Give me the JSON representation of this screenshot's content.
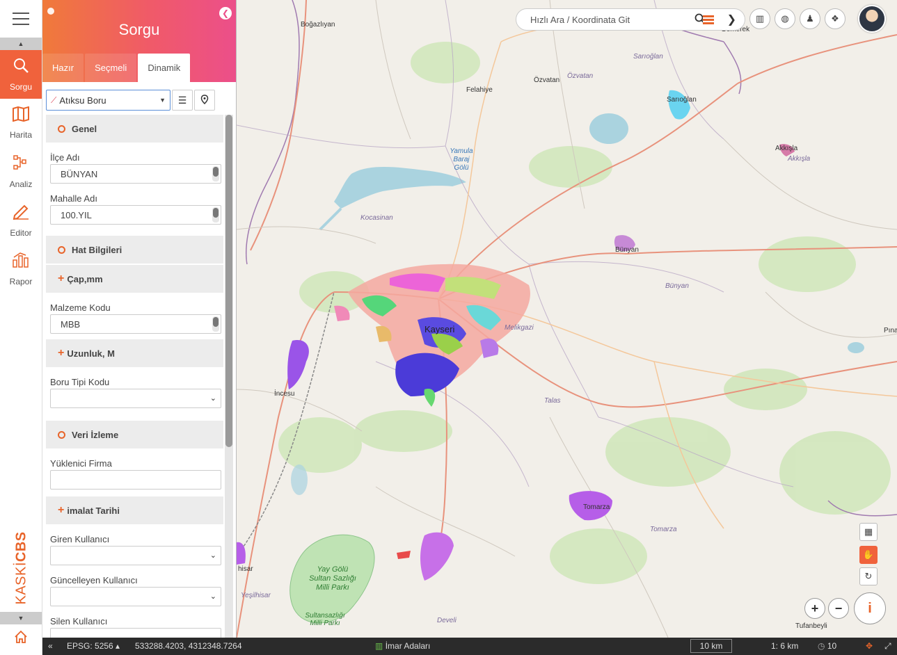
{
  "rail": {
    "items": [
      {
        "label": "Sorgu",
        "icon": "search-icon"
      },
      {
        "label": "Harita",
        "icon": "map-icon"
      },
      {
        "label": "Analiz",
        "icon": "analysis-icon"
      },
      {
        "label": "Editor",
        "icon": "editor-icon"
      },
      {
        "label": "Rapor",
        "icon": "report-icon"
      }
    ],
    "brand_a": "KASKİ",
    "brand_b": "CBS"
  },
  "panel": {
    "title": "Sorgu",
    "tabs": [
      "Hazır",
      "Seçmeli",
      "Dinamik"
    ],
    "active_tab": "Dinamik",
    "layer": "Atıksu Boru"
  },
  "form": {
    "genel": "Genel",
    "ilce_label": "İlçe Adı",
    "ilce_value": "BÜNYAN",
    "mahalle_label": "Mahalle Adı",
    "mahalle_value": "100.YIL",
    "hat": "Hat Bilgileri",
    "cap": "Çap,mm",
    "malzeme_label": "Malzeme Kodu",
    "malzeme_value": "MBB",
    "uzunluk": "Uzunluk, M",
    "boru_tipi_label": "Boru Tipi Kodu",
    "veri": "Veri İzleme",
    "yuklenici_label": "Yüklenici Firma",
    "imalat": "imalat Tarihi",
    "giren_label": "Giren Kullanıcı",
    "guncelleyen_label": "Güncelleyen Kullanıcı",
    "silen_label": "Silen Kullanıcı"
  },
  "map": {
    "search_placeholder": "Hızlı Ara / Koordinata Git",
    "labels": {
      "bogazliyan": "Boğazlıyan",
      "felahiye": "Felahiye",
      "ozvatan": "Özvatan",
      "ozvatan2": "Özvatan",
      "sarioglan": "Sarıoğlan",
      "sarioglan2": "Sarıoğlan",
      "akkisla": "Akkışla",
      "akkisla2": "Akkışla",
      "yamula": "Yamula Baraj Gölü",
      "kocasinan": "Kocasinan",
      "bunyan": "Bünyan",
      "bunyan2": "Bünyan",
      "kayseri": "Kayseri",
      "melikgazi": "Melikgazi",
      "kocasinan_city": "Talas",
      "incesu": "İncesu",
      "talas": "Talas",
      "tomarza": "Tomarza",
      "tomarza2": "Tomarza",
      "sultan": "Yay Gölü Sultan Sazlığı Milli Parkı",
      "sultan2": "Sultansazlığı Milli Parkı",
      "develi": "Develi",
      "yesilhisar": "Yeşilhisar",
      "hisar": "hisar",
      "tufanbeyli": "Tufanbeyli",
      "pinarbasi": "Pına",
      "gomerek": "Gömerek"
    }
  },
  "status": {
    "epsg": "EPSG: 5256",
    "coords": "533288.4203,  4312348.7264",
    "layer": "İmar Adaları",
    "scale_bar": "10 km",
    "ratio": "1: 6 km",
    "zoom": "10"
  },
  "colors": {
    "accent": "#f0623c",
    "brand": "#e8642a",
    "header_gradient_end": "#ec4f8a"
  }
}
